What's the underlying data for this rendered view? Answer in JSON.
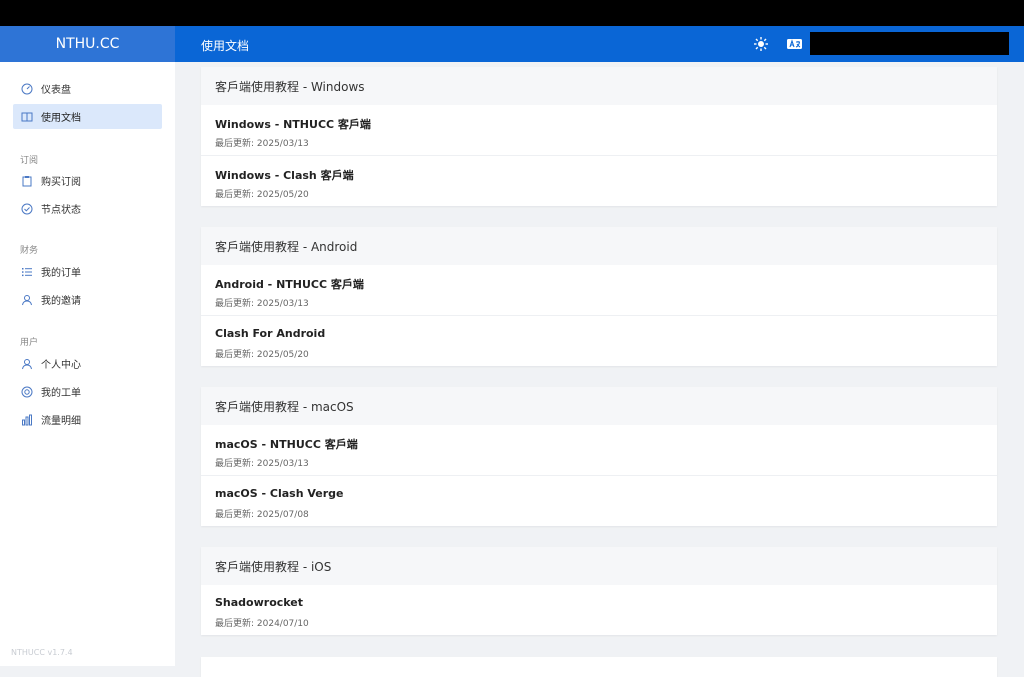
{
  "brand": "NTHU.CC",
  "header": {
    "title": "使用文档"
  },
  "sidebar": {
    "items": [
      {
        "label": "仪表盘",
        "icon": "dashboard-icon"
      },
      {
        "label": "使用文档",
        "icon": "book-icon",
        "active": true
      }
    ],
    "groups": [
      {
        "title": "订阅",
        "items": [
          {
            "label": "购买订阅",
            "icon": "clipboard-icon"
          },
          {
            "label": "节点状态",
            "icon": "check-circle-icon"
          }
        ]
      },
      {
        "title": "财务",
        "items": [
          {
            "label": "我的订单",
            "icon": "list-icon"
          },
          {
            "label": "我的邀请",
            "icon": "invite-icon"
          }
        ]
      },
      {
        "title": "用户",
        "items": [
          {
            "label": "个人中心",
            "icon": "user-icon"
          },
          {
            "label": "我的工单",
            "icon": "lifebuoy-icon"
          },
          {
            "label": "流量明细",
            "icon": "bar-chart-icon"
          }
        ]
      }
    ],
    "version": "NTHUCC v1.7.4"
  },
  "sections": [
    {
      "title": "客戶端使用教程 - Windows",
      "items": [
        {
          "title": "Windows - NTHUCC 客戶端",
          "date": "最后更新: 2025/03/13"
        },
        {
          "title": "Windows - Clash 客戶端",
          "date": "最后更新: 2025/05/20"
        }
      ]
    },
    {
      "title": "客戶端使用教程 - Android",
      "items": [
        {
          "title": "Android - NTHUCC 客戶端",
          "date": "最后更新: 2025/03/13"
        },
        {
          "title": "Clash For Android",
          "date": "最后更新: 2025/05/20"
        }
      ]
    },
    {
      "title": "客戶端使用教程 - macOS",
      "items": [
        {
          "title": "macOS - NTHUCC 客戶端",
          "date": "最后更新: 2025/03/13"
        },
        {
          "title": "macOS - Clash Verge",
          "date": "最后更新: 2025/07/08"
        }
      ]
    },
    {
      "title": "客戶端使用教程 - iOS",
      "items": [
        {
          "title": "Shadowrocket",
          "date": "最后更新: 2024/07/10"
        }
      ]
    }
  ],
  "colors": {
    "accent": "#0a66d6",
    "brand_bg": "#2e74d6",
    "active_bg": "#dbe8fb"
  }
}
